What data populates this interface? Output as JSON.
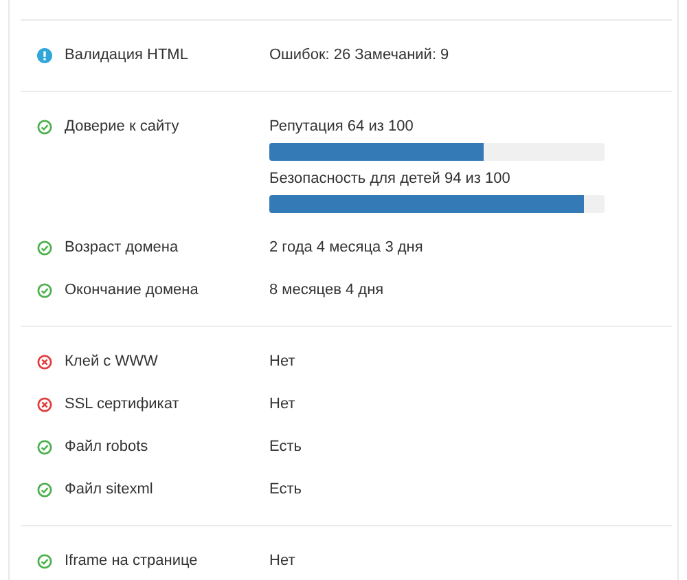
{
  "sections": [
    {
      "rows": [
        {
          "kind": "info",
          "label": "Валидация HTML",
          "value": "Ошибок: 26 Замечаний: 9"
        }
      ]
    },
    {
      "rows": [
        {
          "kind": "ok",
          "label": "Доверие к сайту",
          "meters": [
            {
              "caption": "Репутация 64 из 100",
              "level": 0.64
            },
            {
              "caption": "Безопасность для детей 94 из 100",
              "level": 0.94
            }
          ]
        },
        {
          "kind": "ok",
          "label": "Возраст домена",
          "value": "2 года 4 месяца 3 дня"
        },
        {
          "kind": "ok",
          "label": "Окончание домена",
          "value": "8 месяцев 4 дня"
        }
      ]
    },
    {
      "rows": [
        {
          "kind": "fail",
          "label": "Клей с WWW",
          "value": "Нет"
        },
        {
          "kind": "fail",
          "label": "SSL сертификат",
          "value": "Нет"
        },
        {
          "kind": "ok",
          "label": "Файл robots",
          "value": "Есть"
        },
        {
          "kind": "ok",
          "label": "Файл sitexml",
          "value": "Есть"
        }
      ]
    },
    {
      "rows": [
        {
          "kind": "ok",
          "label": "Iframe на странице",
          "value": "Нет"
        }
      ]
    }
  ]
}
